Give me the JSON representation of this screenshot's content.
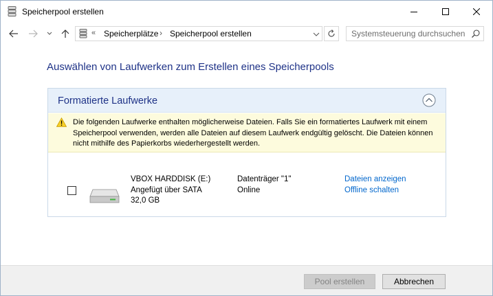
{
  "window": {
    "title": "Speicherpool erstellen"
  },
  "address": {
    "chevron": "«",
    "crumbs": [
      "Speicherplätze",
      "Speicherpool erstellen"
    ],
    "separator": "›"
  },
  "search": {
    "placeholder": "Systemsteuerung durchsuchen"
  },
  "page": {
    "heading": "Auswählen von Laufwerken zum Erstellen eines Speicherpools"
  },
  "group": {
    "title": "Formatierte Laufwerke",
    "warning": "Die folgenden Laufwerke enthalten möglicherweise Dateien. Falls Sie ein formatiertes Laufwerk mit einem Speicherpool verwenden, werden alle Dateien auf diesem Laufwerk endgültig gelöscht. Die Dateien können nicht mithilfe des Papierkorbs wiederhergestellt werden."
  },
  "drive": {
    "checked": false,
    "name": "VBOX HARDDISK (E:)",
    "connection": "Angefügt über SATA",
    "size": "32,0 GB",
    "disk": "Datenträger \"1\"",
    "status": "Online",
    "link_files": "Dateien anzeigen",
    "link_offline": "Offline schalten"
  },
  "footer": {
    "create_label": "Pool erstellen",
    "cancel_label": "Abbrechen"
  },
  "icons": {
    "title": "storage-pool-icon",
    "back": "arrow-left-icon",
    "forward": "arrow-right-icon",
    "recent": "chevron-down-icon",
    "up": "arrow-up-icon",
    "refresh": "refresh-icon",
    "search": "search-icon",
    "collapse": "chevron-up-circle-icon",
    "warning": "warning-icon",
    "drive": "hard-drive-icon"
  },
  "colors": {
    "heading": "#1e3287",
    "link": "#0066cc",
    "group_header_bg": "#e7f0fa",
    "warning_bg": "#fdfbdd"
  }
}
